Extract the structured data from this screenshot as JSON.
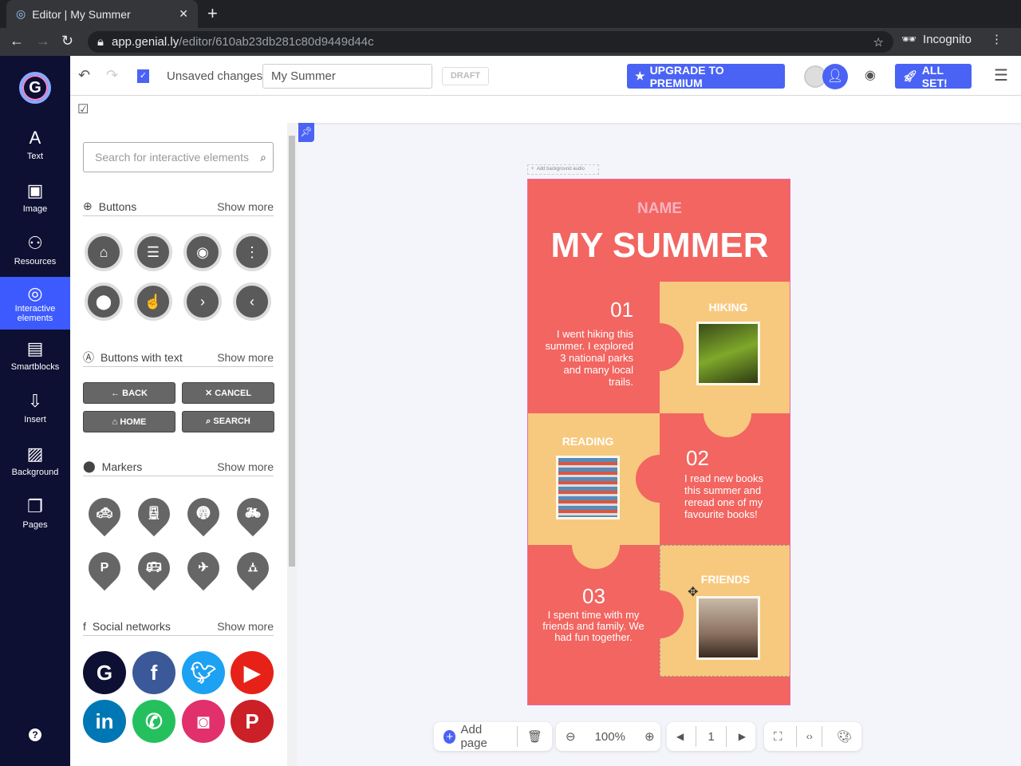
{
  "browser": {
    "tab_title": "Editor | My Summer",
    "url_host": "app.genial.ly",
    "url_path": "/editor/610ab23db281c80d9449d44c",
    "profile": "Incognito"
  },
  "header": {
    "status": "Unsaved changes",
    "title_value": "My Summer",
    "draft": "DRAFT",
    "upgrade": "UPGRADE TO PREMIUM",
    "all_set": "ALL SET!"
  },
  "leftnav": [
    {
      "label": "Text",
      "icon": "A"
    },
    {
      "label": "Image",
      "icon": "▣"
    },
    {
      "label": "Resources",
      "icon": "⚇"
    },
    {
      "label": "Interactive elements",
      "icon": "◎"
    },
    {
      "label": "Smartblocks",
      "icon": "▤"
    },
    {
      "label": "Insert",
      "icon": "⇩"
    },
    {
      "label": "Background",
      "icon": "▨"
    },
    {
      "label": "Pages",
      "icon": "❐"
    }
  ],
  "panel": {
    "search_placeholder": "Search for interactive elements",
    "show_more": "Show more",
    "sections": {
      "buttons": "Buttons",
      "buttons_text": "Buttons with text",
      "markers": "Markers",
      "social": "Social networks"
    },
    "text_buttons": [
      "← BACK",
      "✕ CANCEL",
      "⌂ HOME",
      "⌕ SEARCH"
    ],
    "social_colors": [
      "#0d1033",
      "#3b5998",
      "#1da1f2",
      "#e62117",
      "#0077b5",
      "#25c05e",
      "#e1306c",
      "#cb2027"
    ]
  },
  "slide": {
    "name": "NAME",
    "title": "MY SUMMER",
    "audio": "Add background audio",
    "items": [
      {
        "num": "01",
        "label": "HIKING",
        "text": "I went hiking this summer. I explored 3 national parks and many local trails."
      },
      {
        "num": "02",
        "label": "READING",
        "text": "I read new books this summer and reread one of my favourite books!"
      },
      {
        "num": "03",
        "label": "FRIENDS",
        "text": "I spent time with my friends and family. We had fun together."
      }
    ],
    "colors": {
      "red": "#f26560",
      "yellow": "#f7c97e"
    }
  },
  "bottom": {
    "add_page": "Add page",
    "zoom": "100%",
    "page": "1"
  }
}
